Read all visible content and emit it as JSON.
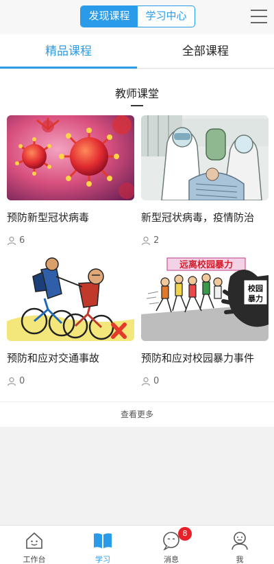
{
  "header": {
    "segments": [
      {
        "label": "发现课程",
        "active": true
      },
      {
        "label": "学习中心",
        "active": false
      }
    ],
    "menu_icon": "hamburger-icon"
  },
  "tabs": [
    {
      "label": "精品课程",
      "active": true
    },
    {
      "label": "全部课程",
      "active": false
    }
  ],
  "section": {
    "title": "教师课堂"
  },
  "courses": [
    {
      "title": "预防新型冠状病毒",
      "count": "6",
      "image": "virus-illustration"
    },
    {
      "title": "新型冠状病毒，疫情防治",
      "count": "2",
      "image": "medical-staff-illustration"
    },
    {
      "title": "预防和应对交通事故",
      "count": "0",
      "image": "cyclists-illustration"
    },
    {
      "title": "预防和应对校园暴力事件",
      "count": "0",
      "image": "school-violence-illustration",
      "image_text": [
        "远离校园暴力",
        "校园",
        "暴力"
      ]
    }
  ],
  "more": {
    "label": "查看更多"
  },
  "bottom_nav": [
    {
      "label": "工作台",
      "icon": "home-icon",
      "active": false
    },
    {
      "label": "学习",
      "icon": "book-icon",
      "active": true
    },
    {
      "label": "消息",
      "icon": "chat-icon",
      "active": false,
      "badge": "8"
    },
    {
      "label": "我",
      "icon": "user-icon",
      "active": false
    }
  ],
  "colors": {
    "accent": "#2a9be8",
    "badge": "#e8202a"
  }
}
